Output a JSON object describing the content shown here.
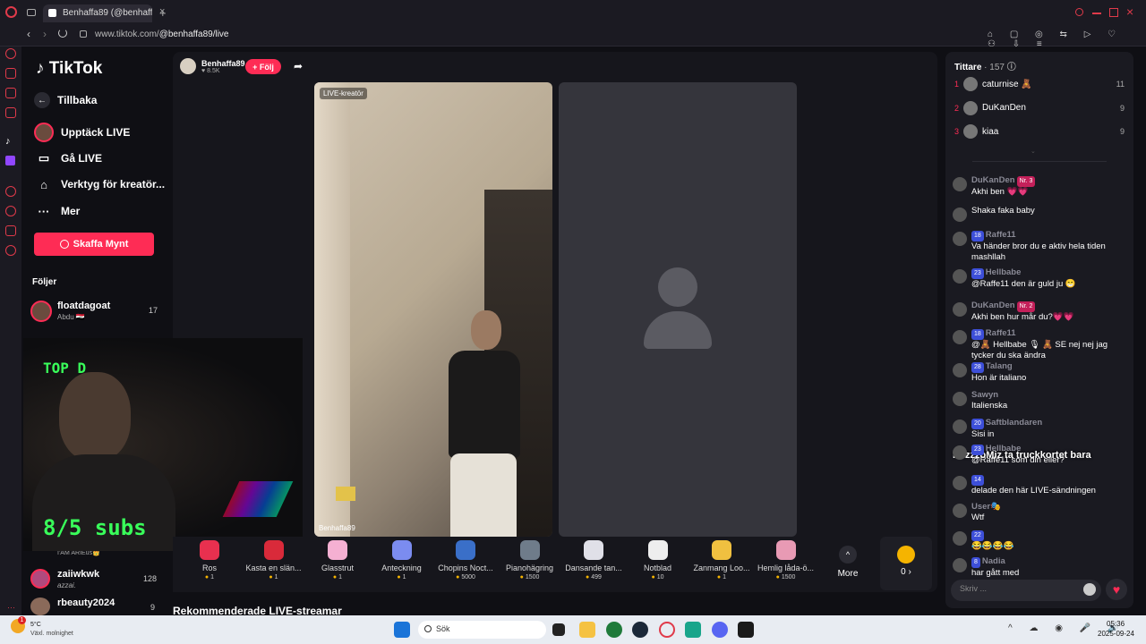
{
  "browser": {
    "tab_title": "Benhaffa89 (@benhaff",
    "url_prefix": "www.tiktok.com/",
    "url_path": "@benhaffa89/live"
  },
  "nav": {
    "logo": "TikTok",
    "back": "Tillbaka",
    "items": [
      "Upptäck LIVE",
      "Gå LIVE",
      "Verktyg för kreatör...",
      "Mer"
    ],
    "coins_button": "Skaffa Mynt",
    "following_heading": "Följer",
    "following": [
      {
        "name": "floatdagoat",
        "sub": "Abdu 🇮🇶",
        "count": "17"
      },
      {
        "name": "zaiiwkwk",
        "sub": "azzai.",
        "count": "128"
      },
      {
        "name": "rbeauty2024",
        "sub": "",
        "count": "9"
      }
    ],
    "partial_follow": "I'AM ARIEus👑",
    "partial_count": "128"
  },
  "stream": {
    "host_name": "Benhaffa89",
    "host_likes": "8.5K",
    "follow_button": "+ Följ",
    "live_label": "LIVE-kreatör",
    "host_caption": "Benhaffa89"
  },
  "webcam_overlay": {
    "top_text": "TOP D",
    "subs_text": "8/5 subs"
  },
  "gifts": [
    {
      "name": "Ros",
      "price": "1",
      "color": "#e8304f"
    },
    {
      "name": "Kasta en slän...",
      "price": "1",
      "color": "#d92a3a"
    },
    {
      "name": "Glasstrut",
      "price": "1",
      "color": "#f5b0d2"
    },
    {
      "name": "Anteckning",
      "price": "1",
      "color": "#7b8cf0"
    },
    {
      "name": "Chopins Noct...",
      "price": "5000",
      "color": "#3a6fc8"
    },
    {
      "name": "Pianohägring",
      "price": "1500",
      "color": "#6f7c8a"
    },
    {
      "name": "Dansande tan...",
      "price": "499",
      "color": "#e0e0e8"
    },
    {
      "name": "Notblad",
      "price": "10",
      "color": "#eeeeee"
    },
    {
      "name": "Zanmang Loo...",
      "price": "1",
      "color": "#f0c040"
    },
    {
      "name": "Hemlig låda-ö...",
      "price": "1500",
      "color": "#e89ab4"
    }
  ],
  "gift_more": "More",
  "coin_balance": "0 ›",
  "recommended_heading": "Rekommenderade LIVE-streamar",
  "viewers": {
    "title": "Tittare",
    "count": "· 157",
    "top": [
      {
        "rank": "1",
        "name": "caturnise 🧸",
        "count": "11"
      },
      {
        "rank": "2",
        "name": "DuKanDen",
        "count": "9"
      },
      {
        "rank": "3",
        "name": "kiaa",
        "count": "9"
      }
    ]
  },
  "chat": [
    {
      "user": "DuKanDen",
      "badge": "",
      "nr": "Nr. 3",
      "text": "Akhi ben 💗💗"
    },
    {
      "user": "",
      "badge": "",
      "nr": "",
      "text": "Shaka faka baby"
    },
    {
      "user": "Raffe11",
      "badge": "18",
      "nr": "",
      "text": "Va händer bror du e aktiv hela tiden mashllah"
    },
    {
      "user": "Hellbabe",
      "badge": "23",
      "nr": "",
      "text": "@Raffe11 den är guld ju 😁"
    },
    {
      "user": "DuKanDen",
      "badge": "",
      "nr": "Nr. 2",
      "text": "Akhi ben hur mår du?💗💗"
    },
    {
      "user": "Raffe11",
      "badge": "18",
      "nr": "",
      "text": "@🧸 Hellbabe 🎙 🧸 SE nej nej jag tycker du ska ändra"
    },
    {
      "user": "Talang",
      "badge": "28",
      "nr": "",
      "text": "Hon är italiano"
    },
    {
      "user": "Sawyn",
      "badge": "",
      "nr": "",
      "text": "Italienska"
    },
    {
      "user": "Saftblandaren",
      "badge": "20",
      "nr": "",
      "text": "Sisi in"
    },
    {
      "user": "Hellbabe",
      "badge": "23",
      "nr": "",
      "text": "@Raffe11 som din eller?"
    },
    {
      "user": "",
      "badge": "14",
      "nr": "",
      "text": "delade den här LIVE-sändningen"
    },
    {
      "user": "User🎭",
      "badge": "",
      "nr": "",
      "text": "Wtf"
    },
    {
      "user": "",
      "badge": "22",
      "nr": "",
      "text": "😂😂😂😂"
    },
    {
      "user": "Nadia",
      "badge": "8",
      "nr": "",
      "text": "har gått med"
    }
  ],
  "overlay_chat": "FrizzzoMiz  ta truckkortet bara",
  "chat_input_placeholder": "Skriv ...",
  "taskbar": {
    "weather_temp": "5°C",
    "weather_desc": "Växl. molnighet",
    "search": "Sök",
    "time": "05:36",
    "date": "2025-09-24"
  }
}
